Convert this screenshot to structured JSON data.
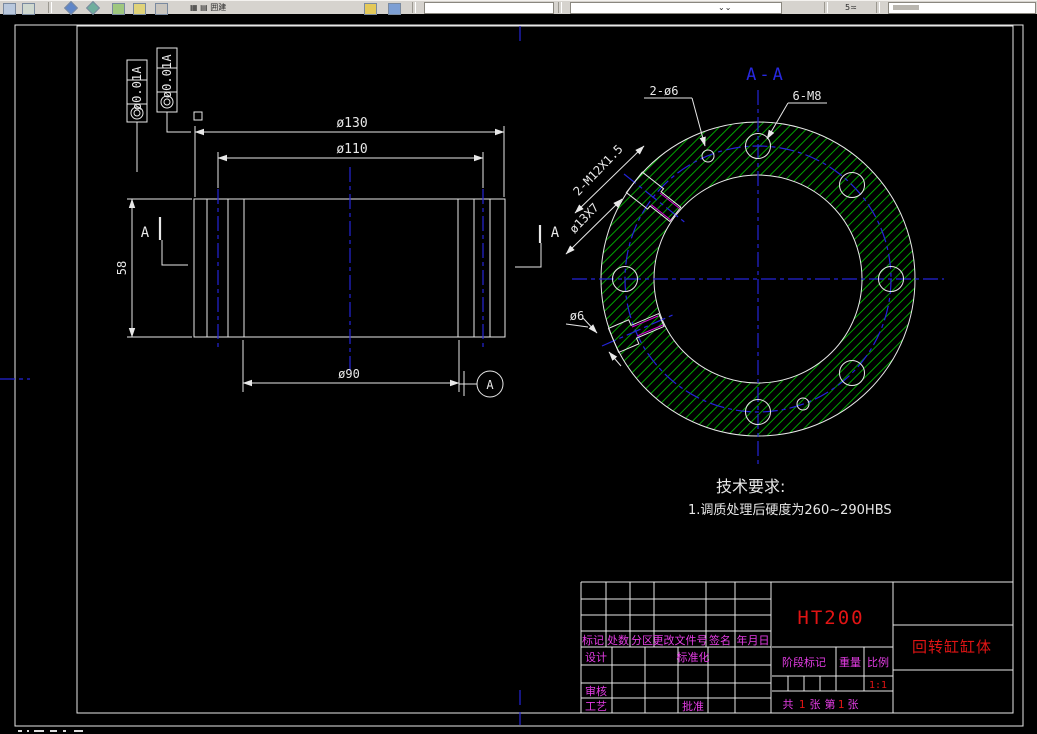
{
  "toolbar": {
    "icons": [
      "doc-icon",
      "print-icon",
      "zoom-diamond-icon",
      "pan-icon",
      "layer-icon",
      "draw-icon",
      "modify-icon",
      "osnap-icon",
      "properties-icon"
    ],
    "combo1_value": "",
    "combo2_value": "",
    "command_box_value": ""
  },
  "front_view": {
    "dim_d130": "ø130",
    "dim_d110": "ø110",
    "dim_d90": "ø90",
    "dim_58": "58",
    "section_label_left": "A",
    "section_label_right": "A",
    "datum_label": "A",
    "gdt1": {
      "tolerance": "ø0.01",
      "datum": "A"
    },
    "gdt2": {
      "tolerance": "ø0.01",
      "datum": "A"
    }
  },
  "section_view": {
    "title": "A-A",
    "label_2_d6": "2-ø6",
    "label_6_m8": "6-M8",
    "label_m12": "2-M12X1.5",
    "label_d13x7": "ø13X7",
    "label_d6": "ø6"
  },
  "tech_req": {
    "title": "技术要求:",
    "item1": "1.调质处理后硬度为260~290HBS"
  },
  "title_block": {
    "row_labels": [
      "标记",
      "处数",
      "分区",
      "更改文件号",
      "签名",
      "年月日"
    ],
    "design": "设计",
    "standardize": "标准化",
    "check": "审核",
    "process": "工艺",
    "approve": "批准",
    "stage_mark": "阶段标记",
    "weight": "重量",
    "scale_label": "比例",
    "scale_value": "1:1",
    "material": "HT200",
    "part_name": "回转缸缸体",
    "sheet": [
      "共",
      "1",
      "张",
      "第",
      "1",
      "张"
    ]
  },
  "colors": {
    "line": "#e8e8e8",
    "hatch_green": "#00b300",
    "centerline_blue": "#2424d8",
    "thread_magenta": "#d800d8",
    "label_magenta": "#e43ce4",
    "value_red": "#e01414",
    "toolbar_gray": "#d6d3ce"
  }
}
